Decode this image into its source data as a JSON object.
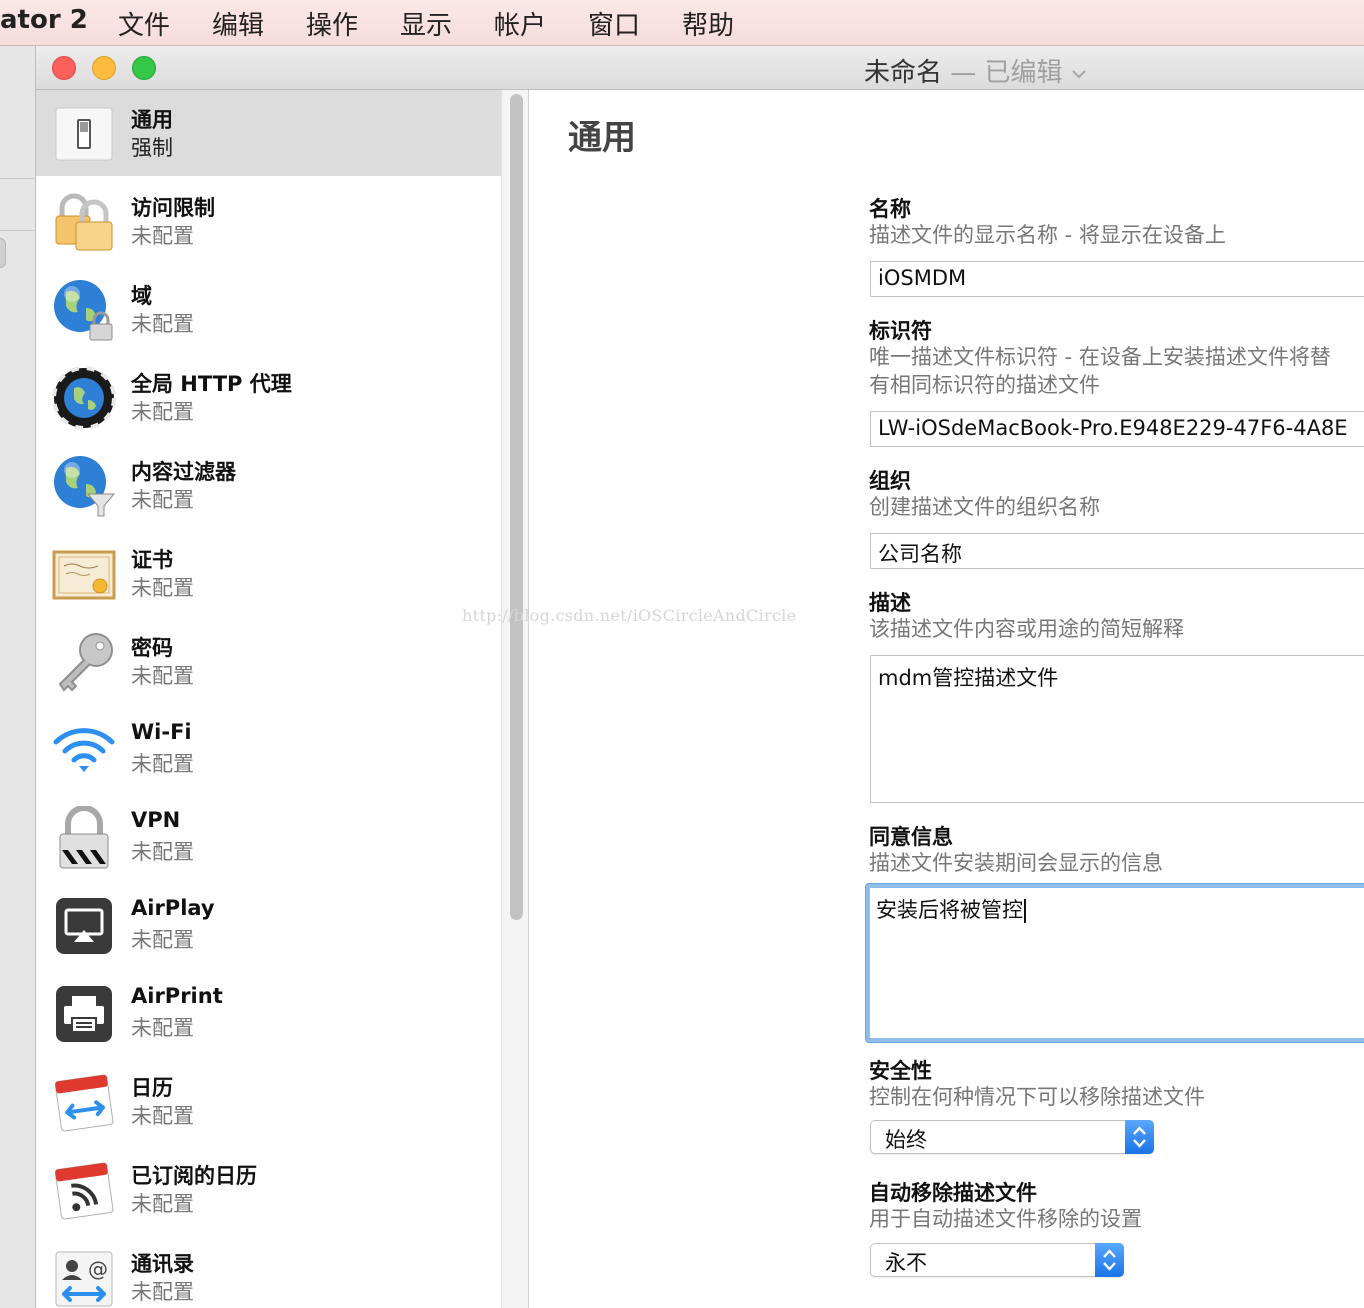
{
  "menubar": {
    "app_name": "ator 2",
    "items": [
      "文件",
      "编辑",
      "操作",
      "显示",
      "帐户",
      "窗口",
      "帮助"
    ]
  },
  "window": {
    "title": "未命名",
    "separator": "—",
    "edited": "已编辑"
  },
  "sidebar": {
    "items": [
      {
        "title": "通用",
        "status": "强制",
        "icon": "switch-icon",
        "selected": true
      },
      {
        "title": "访问限制",
        "status": "未配置",
        "icon": "padlock-icon"
      },
      {
        "title": "域",
        "status": "未配置",
        "icon": "globe-lock-icon"
      },
      {
        "title": "全局 HTTP 代理",
        "status": "未配置",
        "icon": "globe-proxy-icon"
      },
      {
        "title": "内容过滤器",
        "status": "未配置",
        "icon": "globe-filter-icon"
      },
      {
        "title": "证书",
        "status": "未配置",
        "icon": "certificate-icon"
      },
      {
        "title": "密码",
        "status": "未配置",
        "icon": "key-icon"
      },
      {
        "title": "Wi-Fi",
        "status": "未配置",
        "icon": "wifi-icon"
      },
      {
        "title": "VPN",
        "status": "未配置",
        "icon": "vpn-lock-icon"
      },
      {
        "title": "AirPlay",
        "status": "未配置",
        "icon": "airplay-icon"
      },
      {
        "title": "AirPrint",
        "status": "未配置",
        "icon": "printer-icon"
      },
      {
        "title": "日历",
        "status": "未配置",
        "icon": "calendar-sync-icon"
      },
      {
        "title": "已订阅的日历",
        "status": "未配置",
        "icon": "calendar-subscribed-icon"
      },
      {
        "title": "通讯录",
        "status": "未配置",
        "icon": "contacts-icon"
      }
    ]
  },
  "content": {
    "heading": "通用",
    "name": {
      "label": "名称",
      "description": "描述文件的显示名称 - 将显示在设备上",
      "value": "iOSMDM"
    },
    "identifier": {
      "label": "标识符",
      "description_1": "唯一描述文件标识符 - 在设备上安装描述文件将替",
      "description_2": "有相同标识符的描述文件",
      "value": "LW-iOSdeMacBook-Pro.E948E229-47F6-4A8E"
    },
    "organization": {
      "label": "组织",
      "description": "创建描述文件的组织名称",
      "value": "公司名称"
    },
    "description": {
      "label": "描述",
      "description": "该描述文件内容或用途的简短解释",
      "value": "mdm管控描述文件"
    },
    "consent": {
      "label": "同意信息",
      "description": "描述文件安装期间会显示的信息",
      "value": "安装后将被管控"
    },
    "security": {
      "label": "安全性",
      "description": "控制在何种情况下可以移除描述文件",
      "value": "始终"
    },
    "auto_remove": {
      "label": "自动移除描述文件",
      "description": "用于自动描述文件移除的设置",
      "value": "永不"
    }
  },
  "watermark": "http://blog.csdn.net/iOSCircleAndCircle",
  "colors": {
    "focus_ring": "#8fbce9",
    "stepper_blue": "#1a73e8",
    "selected_row": "#dcdcdc"
  }
}
